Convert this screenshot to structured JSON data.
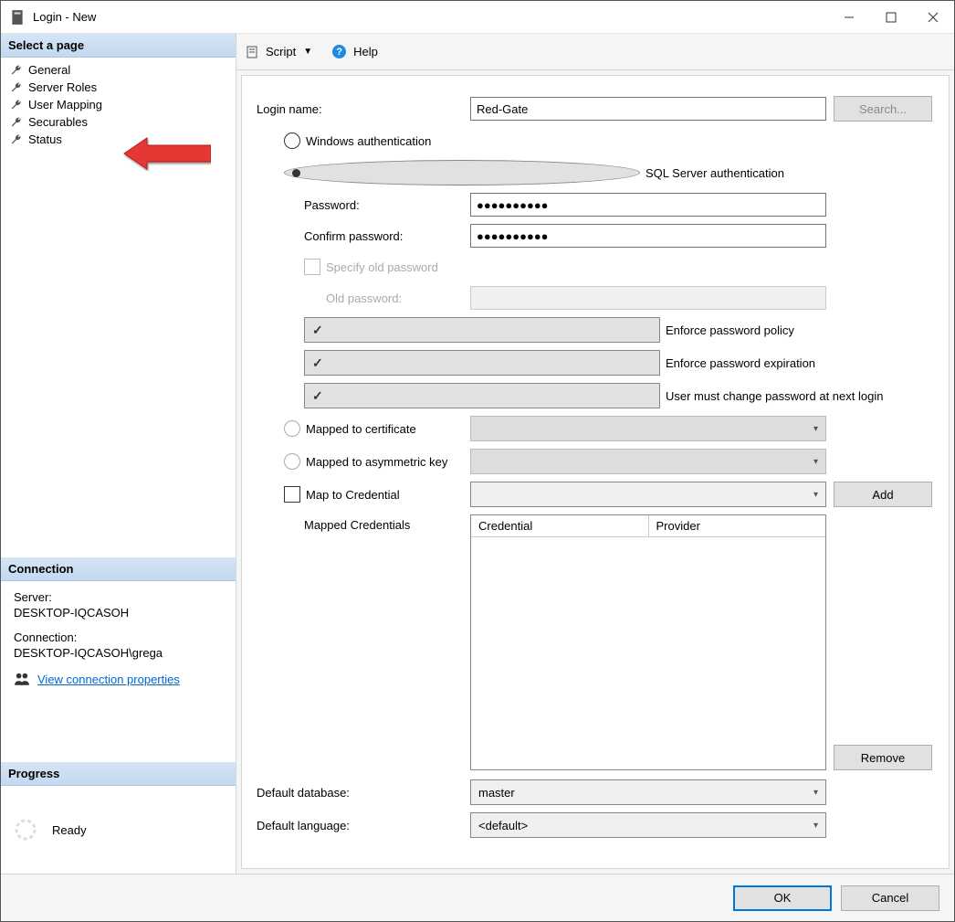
{
  "window": {
    "title": "Login - New"
  },
  "sidebar": {
    "select_page_header": "Select a page",
    "pages": [
      {
        "label": "General"
      },
      {
        "label": "Server Roles"
      },
      {
        "label": "User Mapping"
      },
      {
        "label": "Securables"
      },
      {
        "label": "Status"
      }
    ],
    "connection_header": "Connection",
    "server_label": "Server:",
    "server_value": "DESKTOP-IQCASOH",
    "connection_label": "Connection:",
    "connection_value": "DESKTOP-IQCASOH\\grega",
    "view_conn_link": "View connection properties",
    "progress_header": "Progress",
    "progress_status": "Ready"
  },
  "toolbar": {
    "script": "Script",
    "help": "Help"
  },
  "form": {
    "login_name_label": "Login name:",
    "login_name_value": "Red-Gate",
    "search_btn": "Search...",
    "auth_windows": "Windows authentication",
    "auth_sql": "SQL Server authentication",
    "password_label": "Password:",
    "password_value": "●●●●●●●●●●",
    "confirm_label": "Confirm password:",
    "confirm_value": "●●●●●●●●●●",
    "specify_old": "Specify old password",
    "old_password_label": "Old password:",
    "enforce_policy": "Enforce password policy",
    "enforce_expire": "Enforce password expiration",
    "must_change": "User must change password at next login",
    "mapped_cert": "Mapped to certificate",
    "mapped_asym": "Mapped to asymmetric key",
    "map_cred": "Map to Credential",
    "add_btn": "Add",
    "mapped_creds_label": "Mapped Credentials",
    "cred_col1": "Credential",
    "cred_col2": "Provider",
    "remove_btn": "Remove",
    "default_db_label": "Default database:",
    "default_db_value": "master",
    "default_lang_label": "Default language:",
    "default_lang_value": "<default>"
  },
  "footer": {
    "ok": "OK",
    "cancel": "Cancel"
  }
}
